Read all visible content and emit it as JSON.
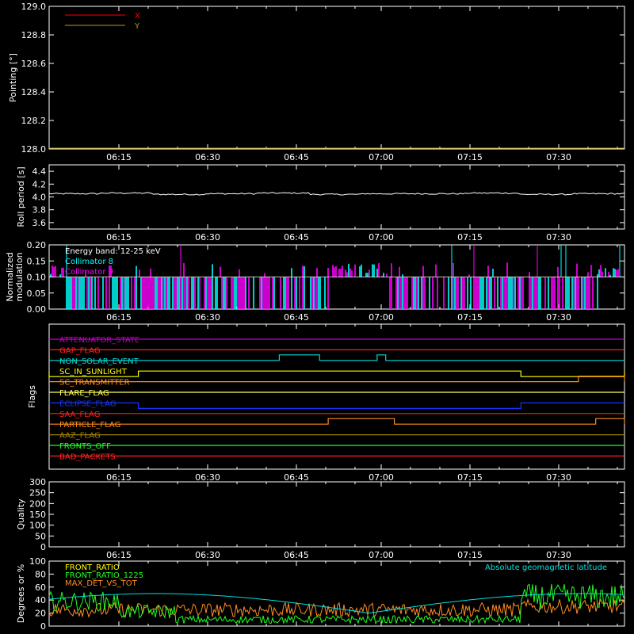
{
  "chart_data": [
    {
      "type": "line",
      "panel": "pointing",
      "ylabel": "Pointing [°]",
      "ylim": [
        128.0,
        129.0
      ],
      "yticks": [
        "128.0",
        "128.2",
        "128.4",
        "128.6",
        "128.8",
        "129.0"
      ],
      "xtick_labels": [
        "06:15",
        "06:30",
        "06:45",
        "07:00",
        "07:15",
        "07:30"
      ],
      "series": [
        {
          "name": "X",
          "color": "#ff0000",
          "values": []
        },
        {
          "name": "Y",
          "color": "#b8a000",
          "values": [
            128.0,
            128.0
          ]
        }
      ]
    },
    {
      "type": "line",
      "panel": "roll",
      "ylabel": "Roll period [s]",
      "ylim": [
        3.5,
        4.5
      ],
      "yticks": [
        "3.6",
        "3.8",
        "4.0",
        "4.2",
        "4.4"
      ],
      "xtick_labels": [
        "06:15",
        "06:30",
        "06:45",
        "07:00",
        "07:15",
        "07:30"
      ],
      "series": [
        {
          "color": "#ffffff",
          "values": [
            4.05,
            4.06,
            4.04,
            4.05,
            4.06,
            4.04,
            4.05,
            4.05,
            4.06,
            4.04,
            4.05
          ]
        }
      ]
    },
    {
      "type": "bar",
      "panel": "modulation",
      "ylabel": "Normalized modulation",
      "ylim": [
        0.0,
        0.2
      ],
      "yticks": [
        "0.00",
        "0.05",
        "0.10",
        "0.15",
        "0.20"
      ],
      "xtick_labels": [
        "06:15",
        "06:30",
        "06:45",
        "07:00",
        "07:15",
        "07:30"
      ],
      "legend_title": "Energy band: 12-25 keV",
      "series": [
        {
          "name": "Collimator 8",
          "color": "#00ffff"
        },
        {
          "name": "Collimator 9",
          "color": "#ff00ff"
        }
      ]
    },
    {
      "type": "line",
      "panel": "flags",
      "ylabel": "Flags",
      "xtick_labels": [
        "06:15",
        "06:30",
        "06:45",
        "07:00",
        "07:15",
        "07:30"
      ],
      "flags": [
        {
          "name": "ATTENUATOR_STATE",
          "color": "#c000c0",
          "steps": []
        },
        {
          "name": "SAA_FLAG",
          "color": "#ff2020",
          "label": "GAP_FLAG",
          "steps": []
        },
        {
          "name": "NON_SOLAR_EVENT",
          "color": "#00d8d8",
          "steps": [
            [
              0.4,
              0.47,
              1
            ],
            [
              0.57,
              0.585,
              1
            ]
          ]
        },
        {
          "name": "SC_IN_SUNLIGHT",
          "color": "#ffff00",
          "steps": [
            [
              0.0,
              0.155,
              -1
            ],
            [
              0.82,
              1.0,
              -1
            ]
          ]
        },
        {
          "name": "SC_TRANSMITTER",
          "color": "#ff8c20",
          "steps": [
            [
              0.92,
              1.0,
              1
            ]
          ]
        },
        {
          "name": "FLARE_FLAG",
          "color": "#ffff60",
          "steps": []
        },
        {
          "name": "ECLIPSE_FLAG",
          "color": "#1830ff",
          "steps": [
            [
              0.155,
              0.82,
              -1
            ]
          ]
        },
        {
          "name": "SAA_FLAG",
          "color": "#ff2020",
          "steps": []
        },
        {
          "name": "PARTICLE_FLAG",
          "color": "#ff8c20",
          "steps": [
            [
              0.485,
              0.6,
              1
            ],
            [
              0.95,
              1.0,
              1
            ]
          ]
        },
        {
          "name": "AAZ_FLAG",
          "color": "#a08000",
          "steps": []
        },
        {
          "name": "FRONTS_OFF",
          "color": "#20ff20",
          "steps": []
        },
        {
          "name": "BAD_PACKETS",
          "color": "#ff2020",
          "steps": []
        }
      ]
    },
    {
      "type": "line",
      "panel": "quality",
      "ylabel": "Quality",
      "ylim": [
        0,
        300
      ],
      "yticks": [
        "0",
        "50",
        "100",
        "150",
        "200",
        "250",
        "300"
      ],
      "xtick_labels": [
        "06:15",
        "06:30",
        "06:45",
        "07:00",
        "07:15",
        "07:30"
      ],
      "series": []
    },
    {
      "type": "line",
      "panel": "ratios",
      "ylabel": "Degrees or %",
      "ylim": [
        0,
        100
      ],
      "yticks": [
        "0",
        "20",
        "40",
        "60",
        "80",
        "100"
      ],
      "xtick_labels": [
        "06:15",
        "06:30",
        "06:45",
        "07:00",
        "07:15",
        "07:30"
      ],
      "series": [
        {
          "name": "FRONT_RATIO",
          "color": "#ffff00"
        },
        {
          "name": "FRONT_RATIO_1225",
          "color": "#20ff20"
        },
        {
          "name": "MAX_DET_VS_TOT",
          "color": "#ff8c20"
        },
        {
          "name": "Absolute geomagnetic latitude",
          "color": "#00e0e0"
        }
      ]
    }
  ]
}
